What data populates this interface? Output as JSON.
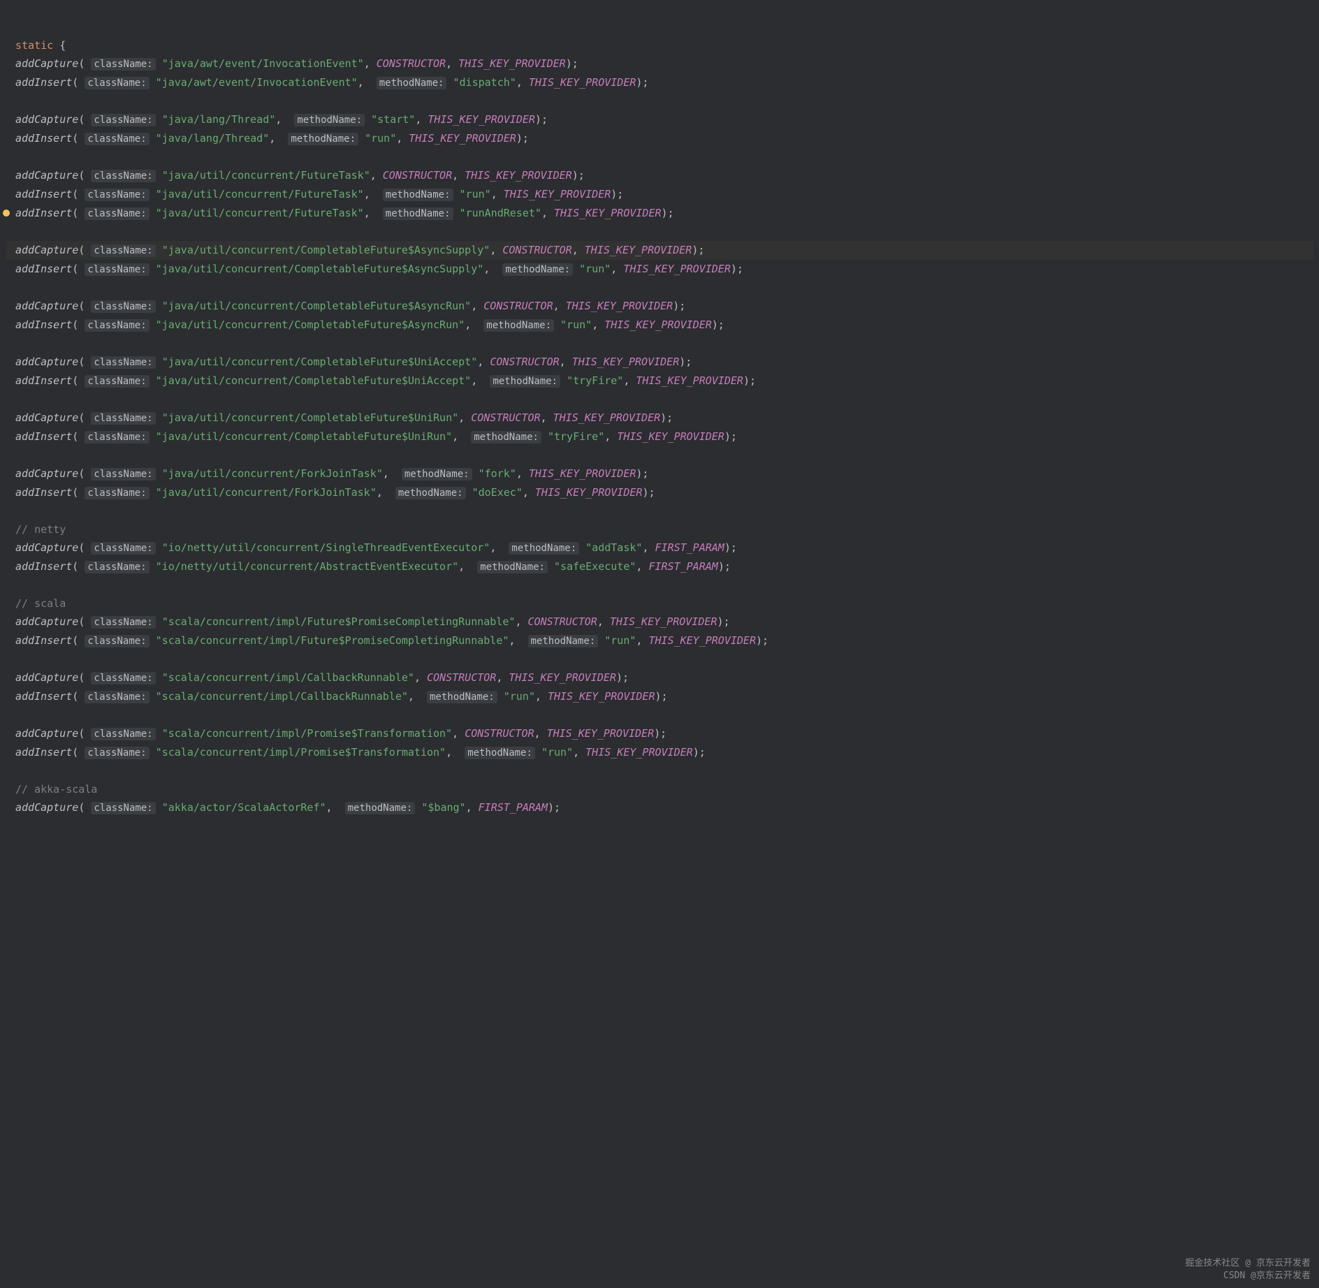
{
  "header": {
    "keyword": "static",
    "brace": "{"
  },
  "labels": {
    "className": "className:",
    "methodName": "methodName:"
  },
  "constants": {
    "CONSTRUCTOR": "CONSTRUCTOR",
    "THIS_KEY_PROVIDER": "THIS_KEY_PROVIDER",
    "FIRST_PARAM": "FIRST_PARAM"
  },
  "fns": {
    "addCapture": "addCapture",
    "addInsert": "addInsert"
  },
  "comments": {
    "netty": "// netty",
    "scala": "// scala",
    "akka": "// akka-scala"
  },
  "lines": [
    {
      "fn": "addCapture",
      "cls": "\"java/awt/event/InvocationEvent\"",
      "meth": null,
      "const": "CONSTRUCTOR",
      "prov": "THIS_KEY_PROVIDER"
    },
    {
      "fn": "addInsert",
      "cls": "\"java/awt/event/InvocationEvent\"",
      "meth": "\"dispatch\"",
      "const": null,
      "prov": "THIS_KEY_PROVIDER"
    },
    {
      "blank": true
    },
    {
      "fn": "addCapture",
      "cls": "\"java/lang/Thread\"",
      "meth": "\"start\"",
      "const": null,
      "prov": "THIS_KEY_PROVIDER"
    },
    {
      "fn": "addInsert",
      "cls": "\"java/lang/Thread\"",
      "meth": "\"run\"",
      "const": null,
      "prov": "THIS_KEY_PROVIDER"
    },
    {
      "blank": true
    },
    {
      "fn": "addCapture",
      "cls": "\"java/util/concurrent/FutureTask\"",
      "meth": null,
      "const": "CONSTRUCTOR",
      "prov": "THIS_KEY_PROVIDER"
    },
    {
      "fn": "addInsert",
      "cls": "\"java/util/concurrent/FutureTask\"",
      "meth": "\"run\"",
      "const": null,
      "prov": "THIS_KEY_PROVIDER"
    },
    {
      "fn": "addInsert",
      "cls": "\"java/util/concurrent/FutureTask\"",
      "meth": "\"runAndReset\"",
      "const": null,
      "prov": "THIS_KEY_PROVIDER",
      "gutter": true
    },
    {
      "blank": true
    },
    {
      "fn": "addCapture",
      "cls": "\"java/util/concurrent/CompletableFuture$AsyncSupply\"",
      "meth": null,
      "const": "CONSTRUCTOR",
      "prov": "THIS_KEY_PROVIDER",
      "hl": true
    },
    {
      "fn": "addInsert",
      "cls": "\"java/util/concurrent/CompletableFuture$AsyncSupply\"",
      "meth": "\"run\"",
      "const": null,
      "prov": "THIS_KEY_PROVIDER"
    },
    {
      "blank": true
    },
    {
      "fn": "addCapture",
      "cls": "\"java/util/concurrent/CompletableFuture$AsyncRun\"",
      "meth": null,
      "const": "CONSTRUCTOR",
      "prov": "THIS_KEY_PROVIDER"
    },
    {
      "fn": "addInsert",
      "cls": "\"java/util/concurrent/CompletableFuture$AsyncRun\"",
      "meth": "\"run\"",
      "const": null,
      "prov": "THIS_KEY_PROVIDER"
    },
    {
      "blank": true
    },
    {
      "fn": "addCapture",
      "cls": "\"java/util/concurrent/CompletableFuture$UniAccept\"",
      "meth": null,
      "const": "CONSTRUCTOR",
      "prov": "THIS_KEY_PROVIDER"
    },
    {
      "fn": "addInsert",
      "cls": "\"java/util/concurrent/CompletableFuture$UniAccept\"",
      "meth": "\"tryFire\"",
      "const": null,
      "prov": "THIS_KEY_PROVIDER"
    },
    {
      "blank": true
    },
    {
      "fn": "addCapture",
      "cls": "\"java/util/concurrent/CompletableFuture$UniRun\"",
      "meth": null,
      "const": "CONSTRUCTOR",
      "prov": "THIS_KEY_PROVIDER"
    },
    {
      "fn": "addInsert",
      "cls": "\"java/util/concurrent/CompletableFuture$UniRun\"",
      "meth": "\"tryFire\"",
      "const": null,
      "prov": "THIS_KEY_PROVIDER"
    },
    {
      "blank": true
    },
    {
      "fn": "addCapture",
      "cls": "\"java/util/concurrent/ForkJoinTask\"",
      "meth": "\"fork\"",
      "const": null,
      "prov": "THIS_KEY_PROVIDER"
    },
    {
      "fn": "addInsert",
      "cls": "\"java/util/concurrent/ForkJoinTask\"",
      "meth": "\"doExec\"",
      "const": null,
      "prov": "THIS_KEY_PROVIDER"
    },
    {
      "blank": true
    },
    {
      "comment": "netty"
    },
    {
      "fn": "addCapture",
      "cls": "\"io/netty/util/concurrent/SingleThreadEventExecutor\"",
      "meth": "\"addTask\"",
      "const": null,
      "prov": "FIRST_PARAM"
    },
    {
      "fn": "addInsert",
      "cls": "\"io/netty/util/concurrent/AbstractEventExecutor\"",
      "meth": "\"safeExecute\"",
      "const": null,
      "prov": "FIRST_PARAM"
    },
    {
      "blank": true
    },
    {
      "comment": "scala"
    },
    {
      "fn": "addCapture",
      "cls": "\"scala/concurrent/impl/Future$PromiseCompletingRunnable\"",
      "meth": null,
      "const": "CONSTRUCTOR",
      "prov": "THIS_KEY_PROVIDER"
    },
    {
      "fn": "addInsert",
      "cls": "\"scala/concurrent/impl/Future$PromiseCompletingRunnable\"",
      "meth": "\"run\"",
      "const": null,
      "prov": "THIS_KEY_PROVIDER"
    },
    {
      "blank": true
    },
    {
      "fn": "addCapture",
      "cls": "\"scala/concurrent/impl/CallbackRunnable\"",
      "meth": null,
      "const": "CONSTRUCTOR",
      "prov": "THIS_KEY_PROVIDER"
    },
    {
      "fn": "addInsert",
      "cls": "\"scala/concurrent/impl/CallbackRunnable\"",
      "meth": "\"run\"",
      "const": null,
      "prov": "THIS_KEY_PROVIDER"
    },
    {
      "blank": true
    },
    {
      "fn": "addCapture",
      "cls": "\"scala/concurrent/impl/Promise$Transformation\"",
      "meth": null,
      "const": "CONSTRUCTOR",
      "prov": "THIS_KEY_PROVIDER"
    },
    {
      "fn": "addInsert",
      "cls": "\"scala/concurrent/impl/Promise$Transformation\"",
      "meth": "\"run\"",
      "const": null,
      "prov": "THIS_KEY_PROVIDER"
    },
    {
      "blank": true
    },
    {
      "comment": "akka"
    },
    {
      "fn": "addCapture",
      "cls": "\"akka/actor/ScalaActorRef\"",
      "meth": "\"$bang\"",
      "const": null,
      "prov": "FIRST_PARAM"
    }
  ],
  "watermark": {
    "line1": "掘金技术社区 @ 京东云开发者",
    "line2": "CSDN @京东云开发者"
  }
}
